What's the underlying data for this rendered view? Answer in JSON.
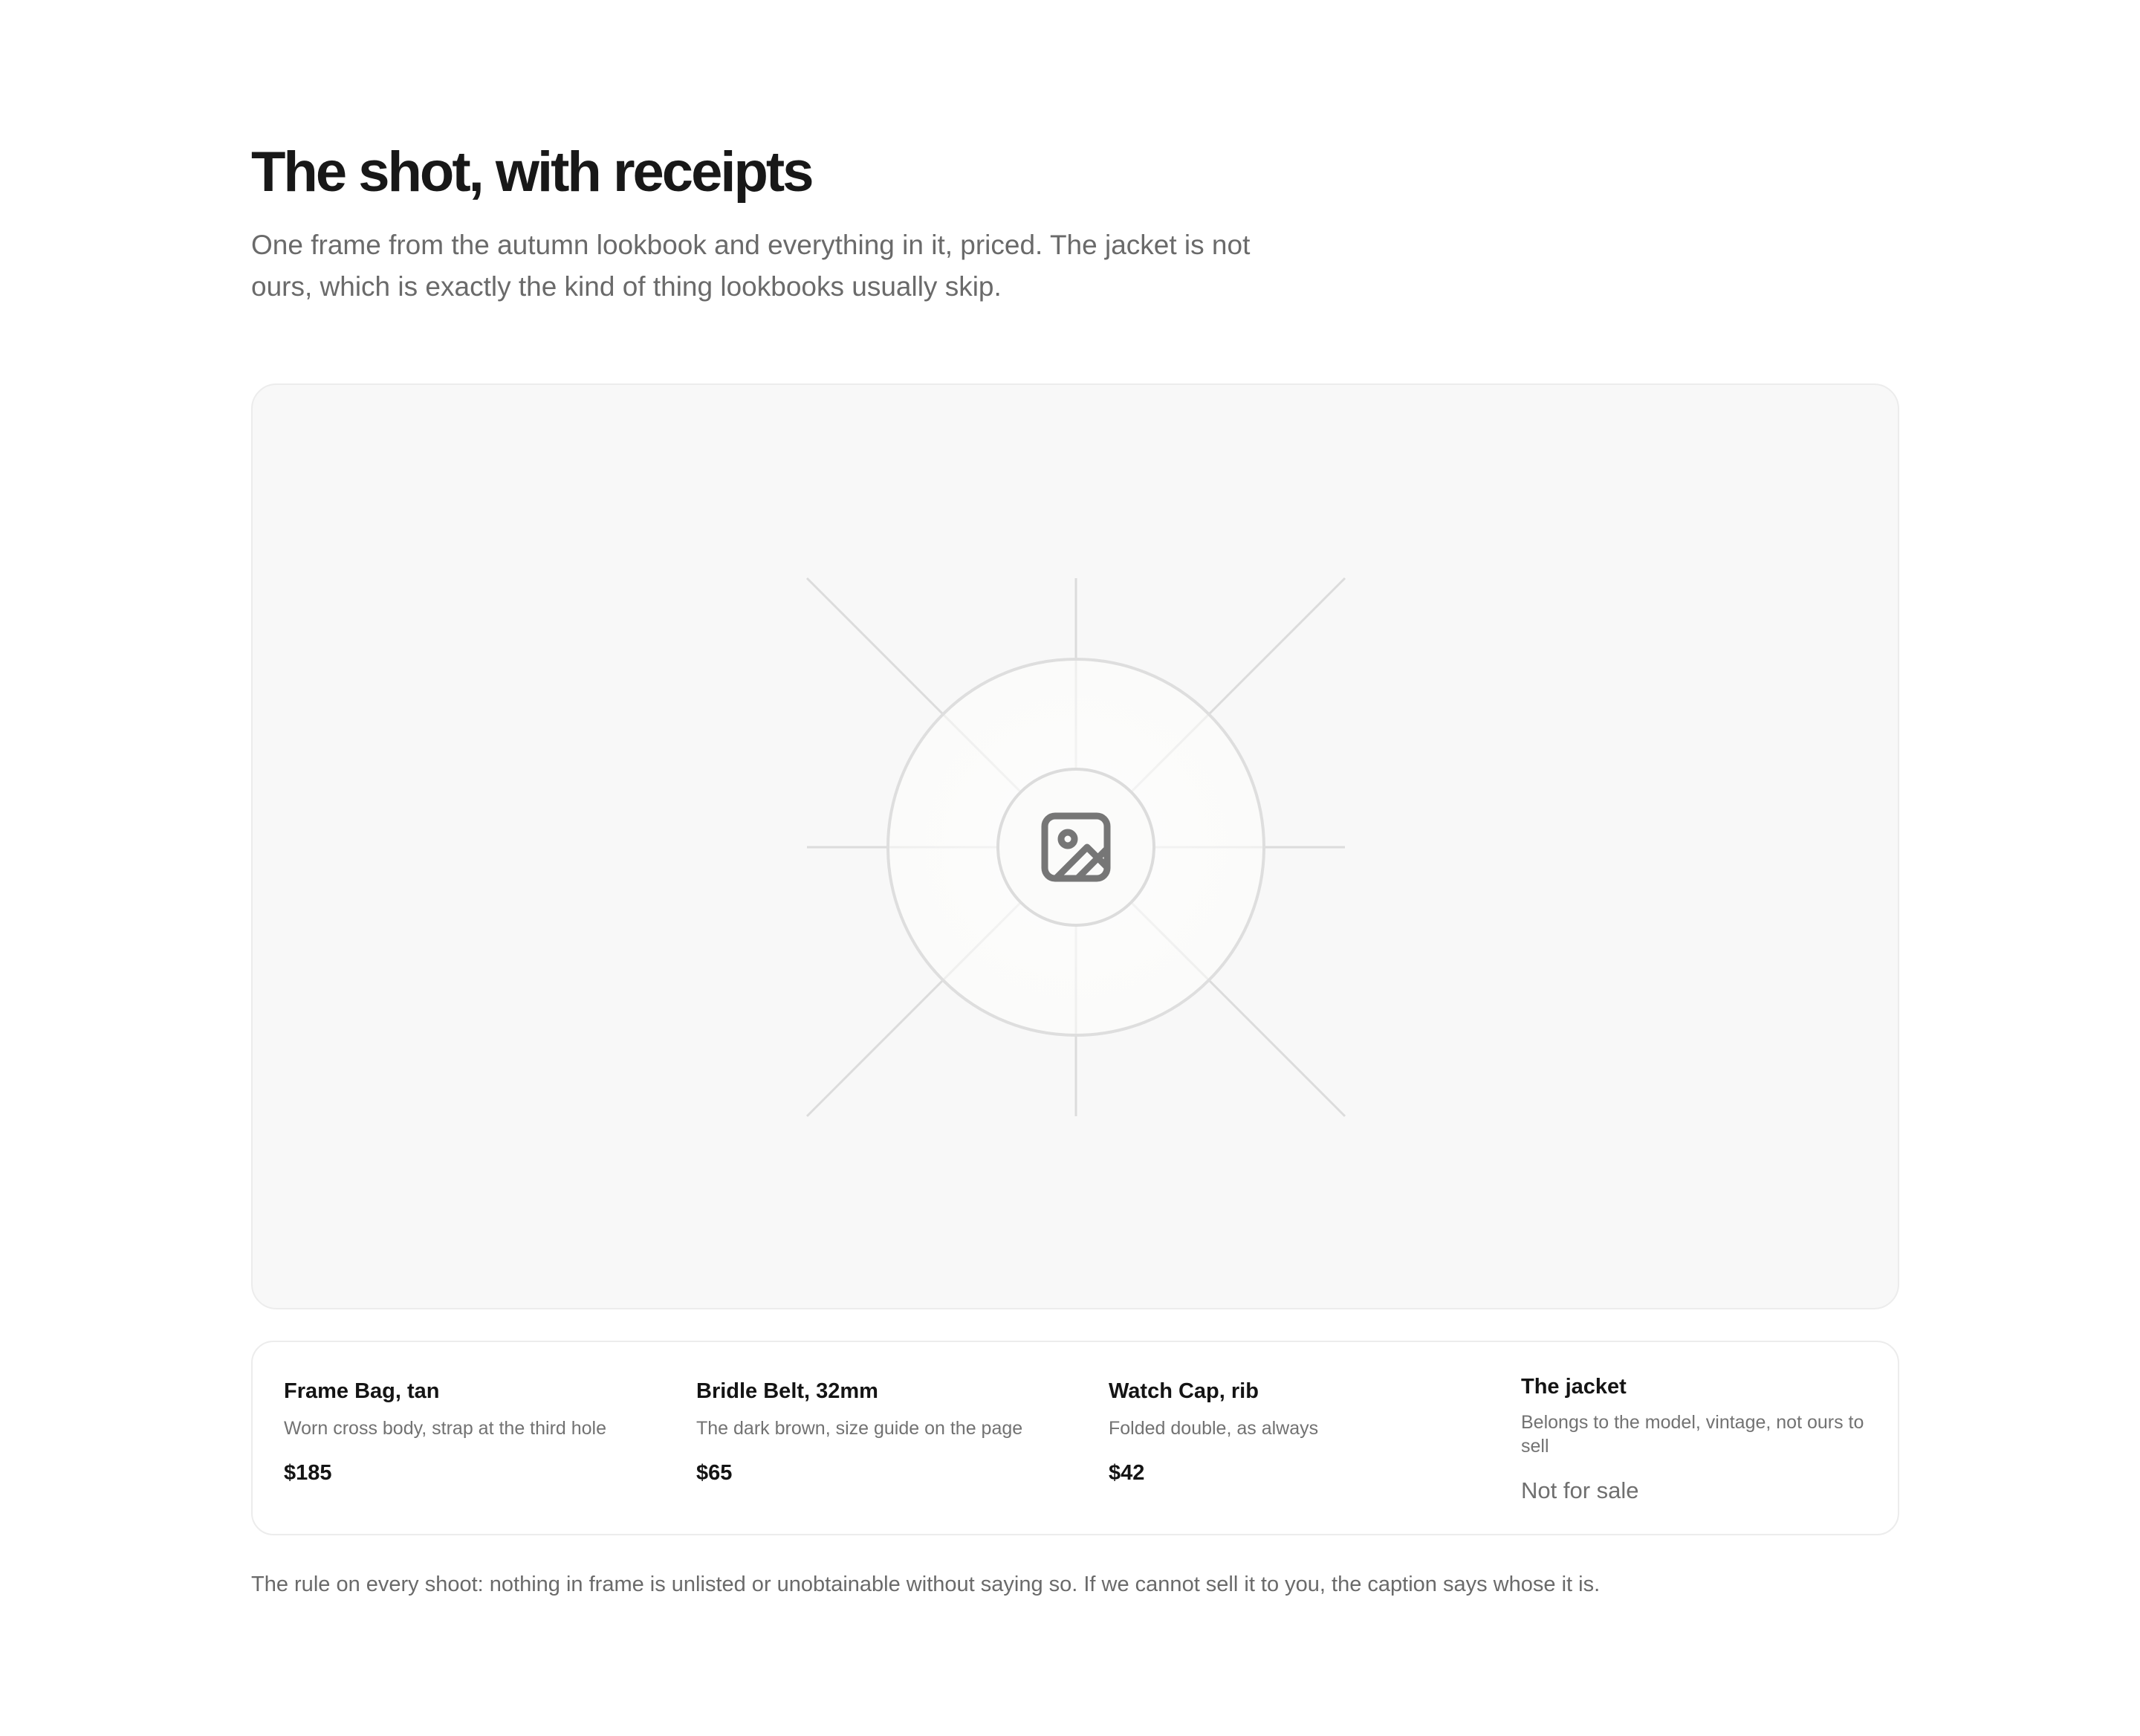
{
  "header": {
    "title": "The shot, with receipts",
    "intro": "One frame from the autumn lookbook and everything in it, priced. The jacket is not ours, which is exactly the kind of thing lookbooks usually skip."
  },
  "figure": {
    "icon": "image-icon",
    "background": "#f8f8f8",
    "line_color": "#dcdcdc",
    "icon_color": "#767676"
  },
  "items": [
    {
      "name": "Frame Bag, tan",
      "note": "Worn cross body, strap at the third hole",
      "price": "$185"
    },
    {
      "name": "Bridle Belt, 32mm",
      "note": "The dark brown, size guide on the page",
      "price": "$65"
    },
    {
      "name": "Watch Cap, rib",
      "note": "Folded double, as always",
      "price": "$42"
    },
    {
      "name": "The jacket",
      "note": "Belongs to the model, vintage, not ours to sell",
      "price": "Not for sale"
    }
  ],
  "footnote": "The rule on every shoot: nothing in frame is unlisted or unobtainable without saying so. If we cannot sell it to you, the caption says whose it is."
}
